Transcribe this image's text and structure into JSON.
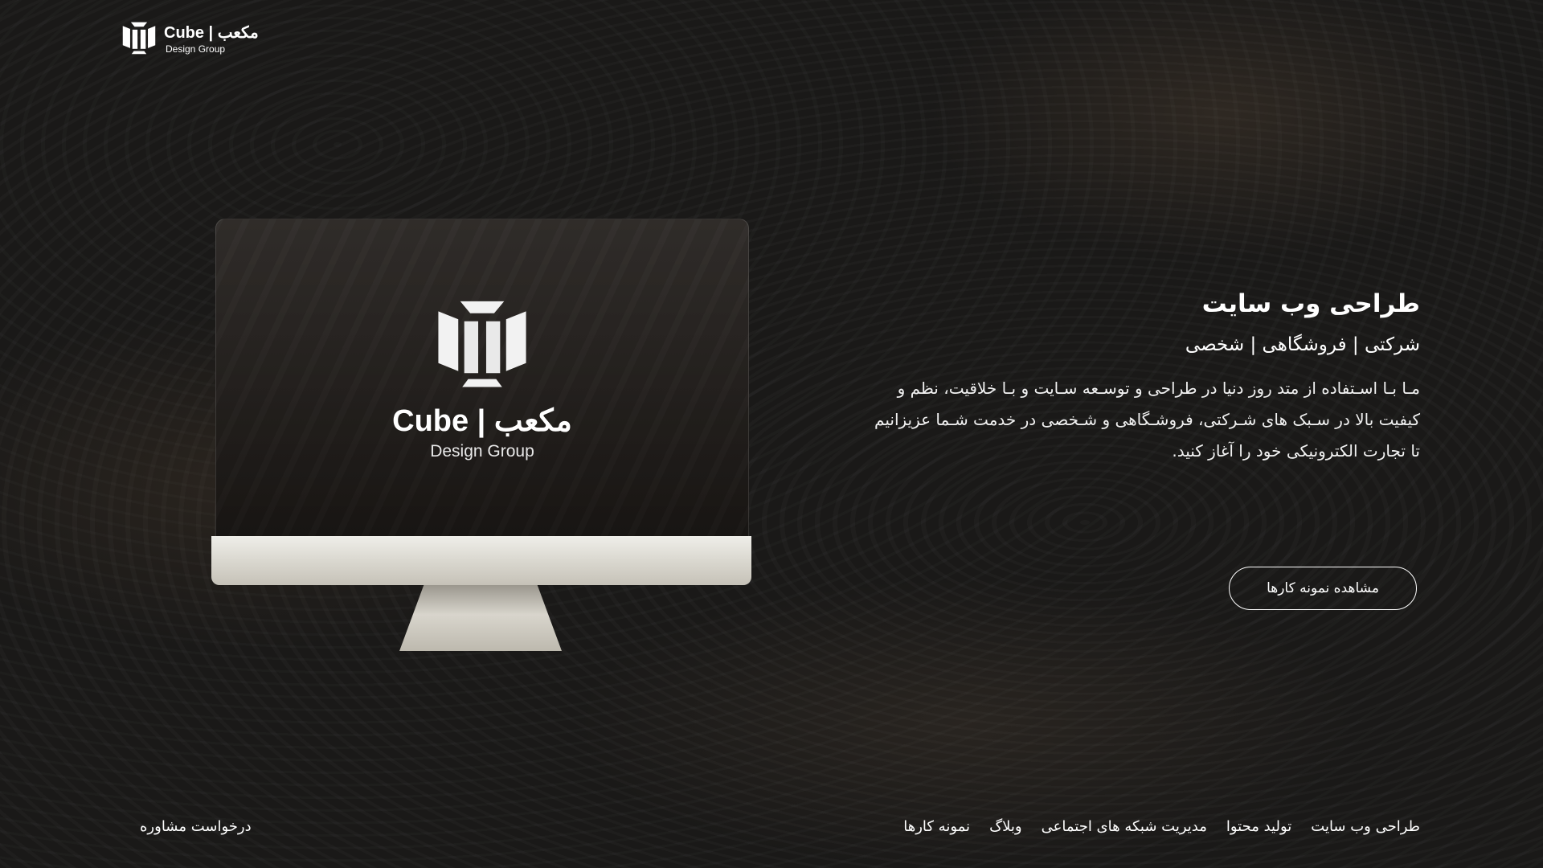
{
  "header": {
    "logo_title": "Cube | مکعب",
    "logo_subtitle": "Design Group"
  },
  "monitor": {
    "logo_title": "Cube | مکعب",
    "logo_subtitle": "Design Group"
  },
  "hero": {
    "title": "طراحی وب سایت",
    "subtitle": "شرکتی | فروشگاهی | شخصی",
    "body": "مـا بـا اسـتفاده از متد روز دنیا در طراحی و توسـعه سـایت و بـا خلاقیت، نظم و کیفیت بالا در سـبک های شـرکتی، فروشـگاهی و شـخصی در خدمت شـما عزیزانیم تا تجارت الکترونیکی خود را آغاز کنید.",
    "cta_label": "مشاهده نمونه کارها"
  },
  "footer": {
    "nav_items": [
      {
        "label": "طراحی وب سایت"
      },
      {
        "label": "تولید محتوا"
      },
      {
        "label": "مدیریت شبکه های اجتماعی"
      },
      {
        "label": "وبلاگ"
      },
      {
        "label": "نمونه کارها"
      }
    ],
    "consult_label": "درخواست مشاوره"
  },
  "colors": {
    "background": "#1a1918",
    "text": "#ffffff",
    "monitor_chin": "#dcdad2"
  },
  "icons": {
    "logo": "cube-logo-icon"
  }
}
